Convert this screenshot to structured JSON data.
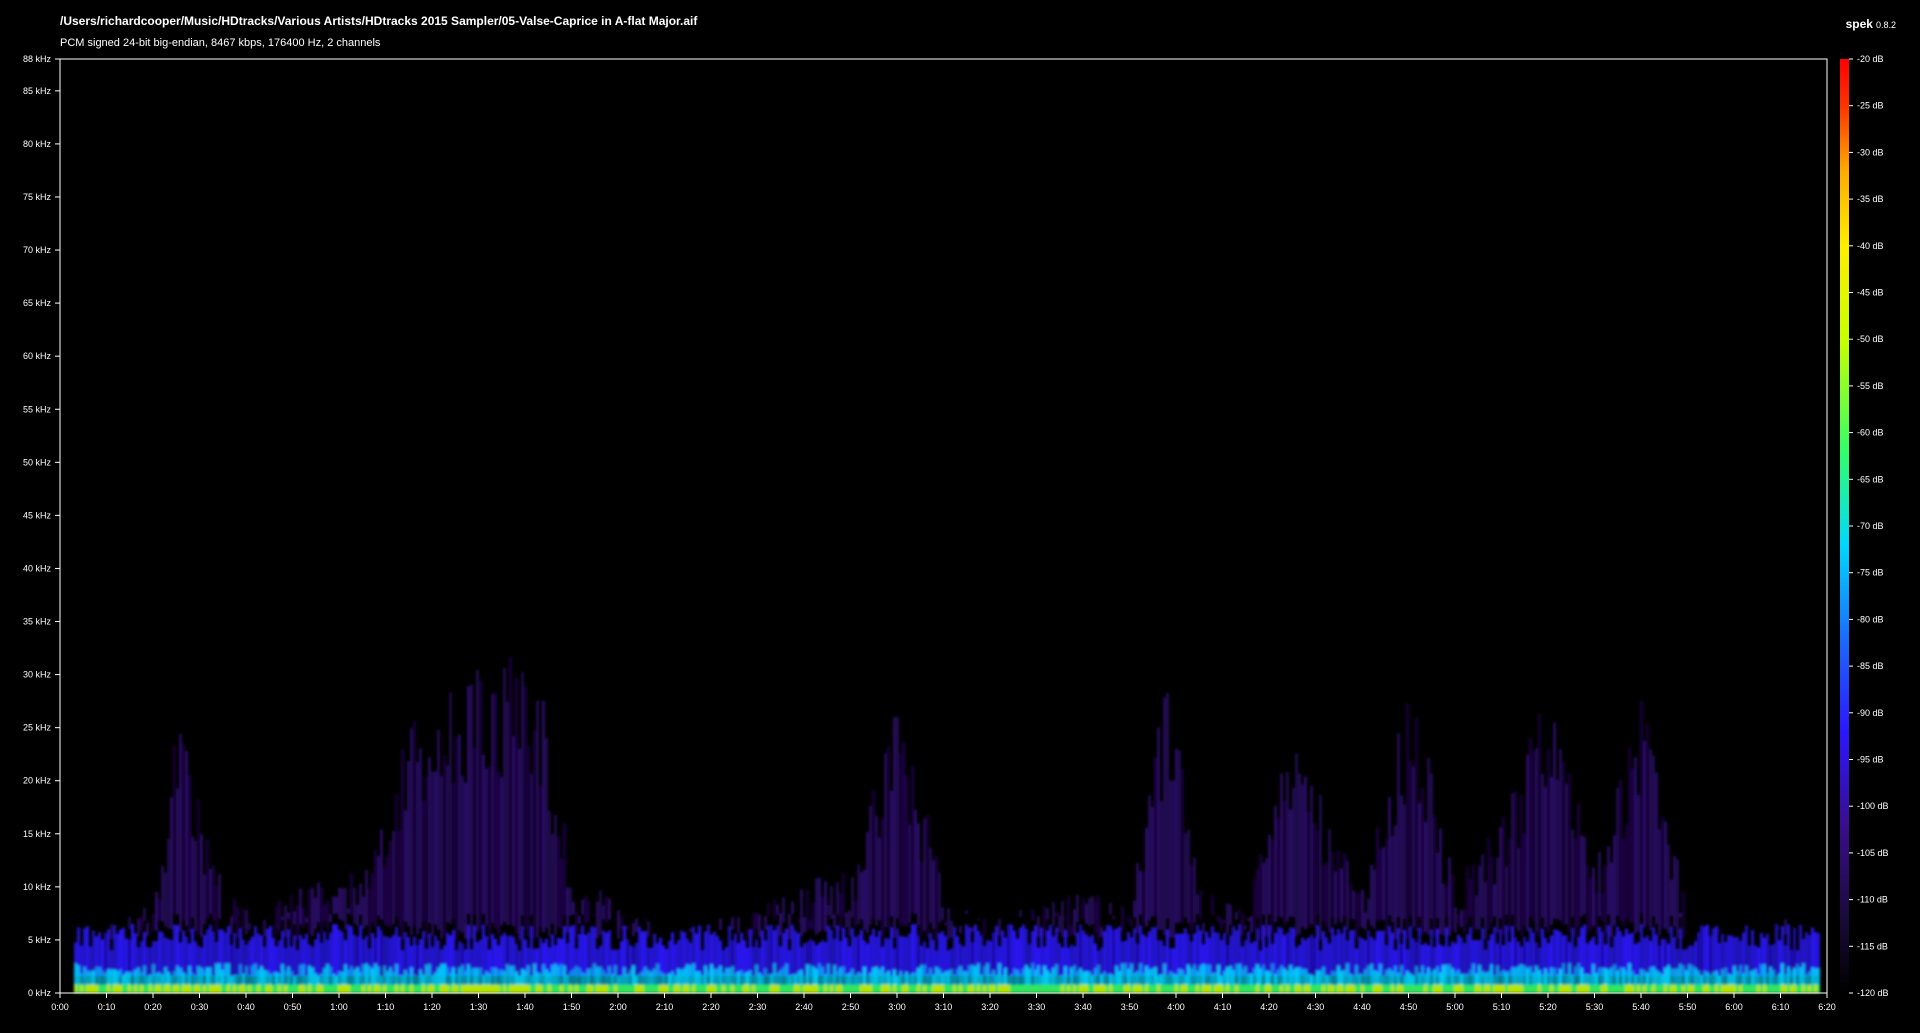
{
  "header": {
    "file_path": "/Users/richardcooper/Music/HDtracks/Various Artists/HDtracks 2015 Sampler/05-Valse-Caprice in A-flat Major.aif",
    "file_info": "PCM signed 24-bit big-endian, 8467 kbps, 176400 Hz, 2 channels",
    "app_name": "spek",
    "app_version": "0.8.2"
  },
  "colors": {
    "background": "#000000",
    "axis": "#ffffff",
    "colormap": [
      "#000000",
      "#1a0a3a",
      "#3a0d8f",
      "#2b17ff",
      "#1a6bff",
      "#00d8ff",
      "#33ff66",
      "#c8ff00",
      "#ffee00",
      "#ffaa00",
      "#ff3300",
      "#ff0000"
    ]
  },
  "chart_data": {
    "type": "heatmap",
    "title": "",
    "xlabel": "",
    "ylabel": "",
    "x_unit": "time (m:ss)",
    "y_unit": "kHz",
    "xlim": [
      "0:00",
      "6:20"
    ],
    "ylim": [
      0,
      88
    ],
    "x_ticks": [
      "0:00",
      "0:10",
      "0:20",
      "0:30",
      "0:40",
      "0:50",
      "1:00",
      "1:10",
      "1:20",
      "1:30",
      "1:40",
      "1:50",
      "2:00",
      "2:10",
      "2:20",
      "2:30",
      "2:40",
      "2:50",
      "3:00",
      "3:10",
      "3:20",
      "3:30",
      "3:40",
      "3:50",
      "4:00",
      "4:10",
      "4:20",
      "4:30",
      "4:40",
      "4:50",
      "5:00",
      "5:10",
      "5:20",
      "5:30",
      "5:40",
      "5:50",
      "6:00",
      "6:10",
      "6:20"
    ],
    "y_ticks": [
      "0 kHz",
      "5 kHz",
      "10 kHz",
      "15 kHz",
      "20 kHz",
      "25 kHz",
      "30 kHz",
      "35 kHz",
      "40 kHz",
      "45 kHz",
      "50 kHz",
      "55 kHz",
      "60 kHz",
      "65 kHz",
      "70 kHz",
      "75 kHz",
      "80 kHz",
      "85 kHz",
      "88 kHz"
    ],
    "colorbar": {
      "ticks": [
        "-20 dB",
        "-25 dB",
        "-30 dB",
        "-35 dB",
        "-40 dB",
        "-45 dB",
        "-50 dB",
        "-55 dB",
        "-60 dB",
        "-65 dB",
        "-70 dB",
        "-75 dB",
        "-80 dB",
        "-85 dB",
        "-90 dB",
        "-95 dB",
        "-100 dB",
        "-105 dB",
        "-110 dB",
        "-115 dB",
        "-120 dB"
      ],
      "range_db": [
        -120,
        -20
      ]
    },
    "energy_envelope_khz": [
      {
        "t": 0,
        "high": 0
      },
      {
        "t": 3,
        "high": 5
      },
      {
        "t": 10,
        "high": 6
      },
      {
        "t": 20,
        "high": 7
      },
      {
        "t": 25,
        "high": 22
      },
      {
        "t": 35,
        "high": 8
      },
      {
        "t": 45,
        "high": 7
      },
      {
        "t": 55,
        "high": 9
      },
      {
        "t": 65,
        "high": 10
      },
      {
        "t": 75,
        "high": 22
      },
      {
        "t": 85,
        "high": 26
      },
      {
        "t": 95,
        "high": 27
      },
      {
        "t": 102,
        "high": 27
      },
      {
        "t": 110,
        "high": 10
      },
      {
        "t": 120,
        "high": 7
      },
      {
        "t": 130,
        "high": 5
      },
      {
        "t": 140,
        "high": 6
      },
      {
        "t": 150,
        "high": 7
      },
      {
        "t": 160,
        "high": 9
      },
      {
        "t": 170,
        "high": 10
      },
      {
        "t": 180,
        "high": 24
      },
      {
        "t": 190,
        "high": 8
      },
      {
        "t": 200,
        "high": 6
      },
      {
        "t": 210,
        "high": 7
      },
      {
        "t": 220,
        "high": 8
      },
      {
        "t": 230,
        "high": 7
      },
      {
        "t": 238,
        "high": 26
      },
      {
        "t": 245,
        "high": 8
      },
      {
        "t": 255,
        "high": 7
      },
      {
        "t": 265,
        "high": 21
      },
      {
        "t": 280,
        "high": 8
      },
      {
        "t": 290,
        "high": 25
      },
      {
        "t": 300,
        "high": 9
      },
      {
        "t": 310,
        "high": 14
      },
      {
        "t": 320,
        "high": 25
      },
      {
        "t": 330,
        "high": 10
      },
      {
        "t": 340,
        "high": 25
      },
      {
        "t": 350,
        "high": 6
      },
      {
        "t": 360,
        "high": 5
      },
      {
        "t": 370,
        "high": 6
      },
      {
        "t": 378,
        "high": 4
      },
      {
        "t": 380,
        "high": 0
      }
    ]
  }
}
